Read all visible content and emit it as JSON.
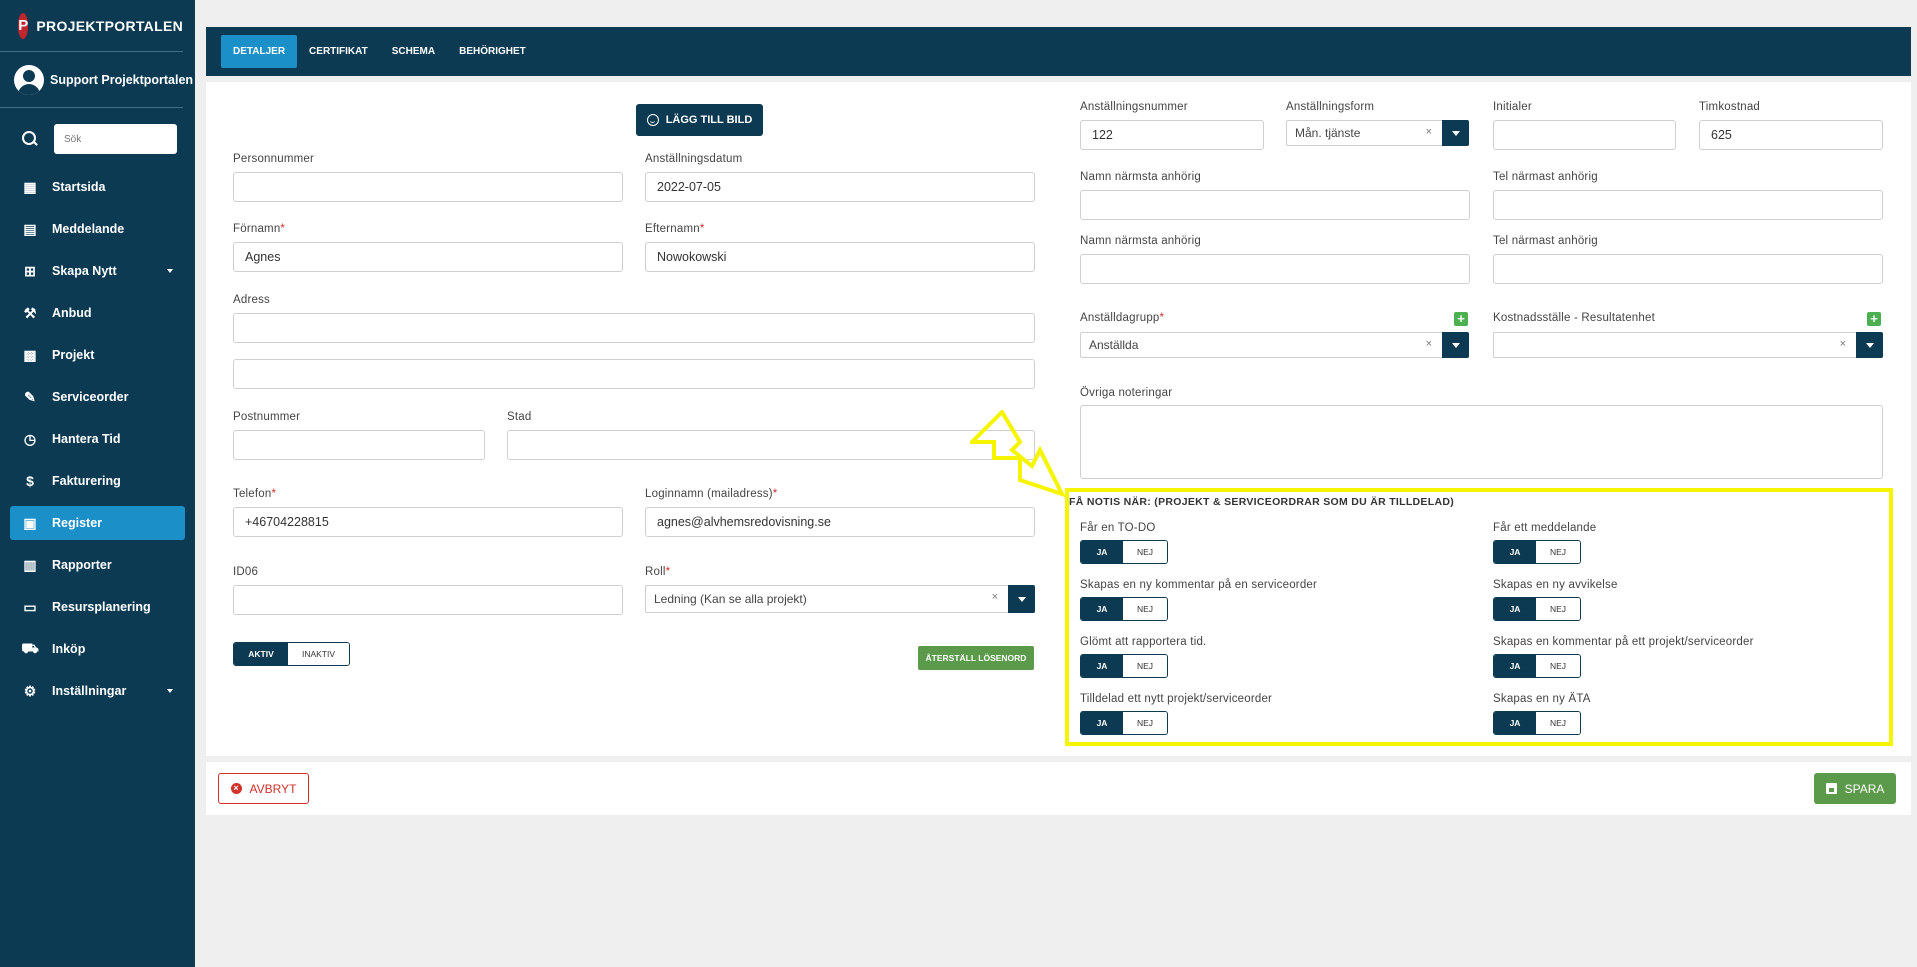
{
  "brand": {
    "name": "PROJEKTPORTALEN",
    "logo_letter": "P"
  },
  "user": {
    "name": "Support Projektportalen"
  },
  "search": {
    "placeholder": "Sök"
  },
  "nav": [
    {
      "label": "Startsida",
      "icon": "dashboard-icon",
      "glyph": "▦"
    },
    {
      "label": "Meddelande",
      "icon": "message-icon",
      "glyph": "▤"
    },
    {
      "label": "Skapa Nytt",
      "icon": "add-box-icon",
      "glyph": "⊞",
      "has_submenu": true
    },
    {
      "label": "Anbud",
      "icon": "gavel-icon",
      "glyph": "⚒"
    },
    {
      "label": "Projekt",
      "icon": "widgets-icon",
      "glyph": "▩"
    },
    {
      "label": "Serviceorder",
      "icon": "wrench-icon",
      "glyph": "✎"
    },
    {
      "label": "Hantera Tid",
      "icon": "clock-icon",
      "glyph": "◷"
    },
    {
      "label": "Fakturering",
      "icon": "dollar-icon",
      "glyph": "$"
    },
    {
      "label": "Register",
      "icon": "image-icon",
      "glyph": "▣",
      "active": true
    },
    {
      "label": "Rapporter",
      "icon": "calendar-icon",
      "glyph": "▥"
    },
    {
      "label": "Resursplanering",
      "icon": "calendar-blank-icon",
      "glyph": "▭"
    },
    {
      "label": "Inköp",
      "icon": "cart-icon",
      "glyph": "⛟"
    },
    {
      "label": "Inställningar",
      "icon": "gear-icon",
      "glyph": "⚙",
      "has_submenu": true
    }
  ],
  "tabs": [
    {
      "label": "DETALJER",
      "active": true
    },
    {
      "label": "CERTIFIKAT"
    },
    {
      "label": "SCHEMA"
    },
    {
      "label": "BEHÖRIGHET"
    }
  ],
  "form": {
    "add_image_label": "LÄGG TILL BILD",
    "personnummer": {
      "label": "Personnummer",
      "value": ""
    },
    "anstallningsdatum": {
      "label": "Anställningsdatum",
      "value": "2022-07-05"
    },
    "fornamn": {
      "label": "Förnamn",
      "value": "Agnes",
      "required_mark": "*"
    },
    "efternamn": {
      "label": "Efternamn",
      "value": "Nowokowski",
      "required_mark": "*"
    },
    "adress": {
      "label": "Adress",
      "value": "",
      "value2": ""
    },
    "postnummer": {
      "label": "Postnummer",
      "value": ""
    },
    "stad": {
      "label": "Stad",
      "value": ""
    },
    "telefon": {
      "label": "Telefon",
      "value": "+46704228815",
      "required_mark": "*"
    },
    "loginnamn": {
      "label": "Loginnamn (mailadress)",
      "value": "agnes@alvhemsredovisning.se",
      "required_mark": "*"
    },
    "id06": {
      "label": "ID06",
      "value": ""
    },
    "roll": {
      "label": "Roll",
      "value": "Ledning (Kan se alla projekt)",
      "required_mark": "*",
      "clear": "×"
    },
    "status_toggle": {
      "on": "AKTIV",
      "off": "INAKTIV"
    },
    "reset_password_label": "ÅTERSTÄLL LÖSENORD",
    "anstallningsnummer": {
      "label": "Anställningsnummer",
      "value": "122"
    },
    "anstallningsform": {
      "label": "Anställningsform",
      "value": "Mån. tjänste",
      "clear": "×"
    },
    "initialer": {
      "label": "Initialer",
      "value": ""
    },
    "timkostnad": {
      "label": "Timkostnad",
      "value": "625"
    },
    "anhorig1_namn": {
      "label": "Namn närmsta anhörig",
      "value": ""
    },
    "anhorig1_tel": {
      "label": "Tel närmast anhörig",
      "value": ""
    },
    "anhorig2_namn": {
      "label": "Namn närmsta anhörig",
      "value": ""
    },
    "anhorig2_tel": {
      "label": "Tel närmast anhörig",
      "value": ""
    },
    "anstalldagrupp": {
      "label": "Anställdagrupp",
      "value": "Anställda",
      "required_mark": "*",
      "clear": "×",
      "plus": "+"
    },
    "kostnadsstalle": {
      "label": "Kostnadsställe - Resultatenhet",
      "value": "",
      "clear": "×",
      "plus": "+"
    },
    "ovriga": {
      "label": "Övriga noteringar",
      "value": ""
    }
  },
  "notis": {
    "title": "FÅ NOTIS NÄR: (PROJEKT & SERVICEORDRAR SOM DU ÄR TILLDELAD)",
    "yes": "JA",
    "no": "NEJ",
    "items": [
      {
        "label": "Får en TO-DO",
        "value": "JA"
      },
      {
        "label": "Får ett meddelande",
        "value": "JA"
      },
      {
        "label": "Skapas en ny kommentar på en serviceorder",
        "value": "JA"
      },
      {
        "label": "Skapas en ny avvikelse",
        "value": "JA"
      },
      {
        "label": "Glömt att rapportera tid.",
        "value": "JA"
      },
      {
        "label": "Skapas en kommentar på ett projekt/serviceorder",
        "value": "JA"
      },
      {
        "label": "Tilldelad ett nytt projekt/serviceorder",
        "value": "JA"
      },
      {
        "label": "Skapas en ny ÄTA",
        "value": "JA"
      }
    ]
  },
  "footer": {
    "cancel_label": "AVBRYT",
    "save_label": "SPARA"
  },
  "colors": {
    "sidebar": "#0b3a52",
    "accent": "#1b8fc7",
    "success": "#5a9a4a",
    "danger": "#d0312d",
    "highlight": "#f5f500"
  }
}
